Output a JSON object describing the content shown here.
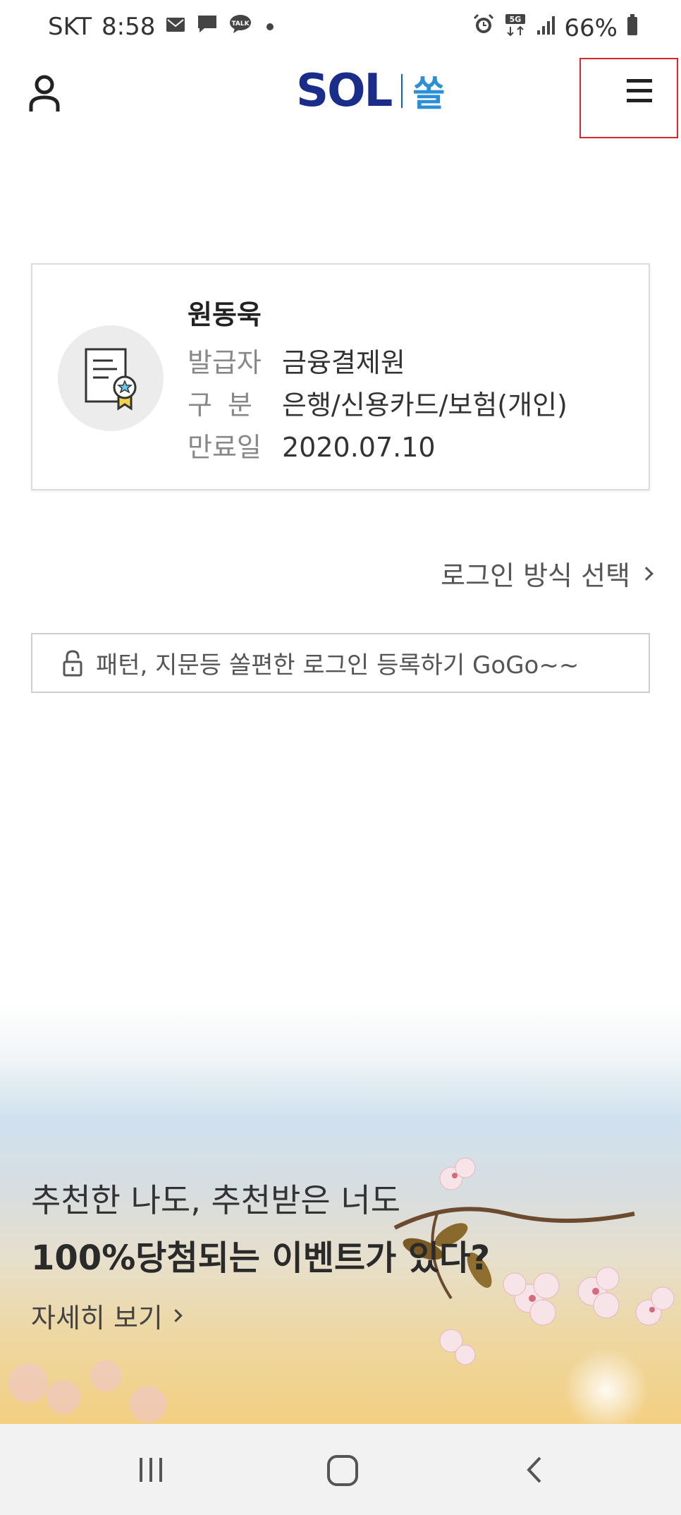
{
  "status_bar": {
    "carrier": "SKT",
    "time": "8:58",
    "network": "5G",
    "battery": "66%",
    "icons_left": [
      "mail-icon",
      "chat-icon",
      "talk-icon",
      "dot-icon"
    ],
    "icons_right": [
      "alarm-icon",
      "5g-icon",
      "signal-icon",
      "battery-icon"
    ]
  },
  "header": {
    "logo_text": "SOL",
    "logo_korean": "쏠",
    "user_icon": "user-icon",
    "menu_icon": "hamburger-menu-icon"
  },
  "certificate": {
    "name": "원동욱",
    "rows": [
      {
        "label": "발급자",
        "value": "금융결제원"
      },
      {
        "label": "구분",
        "value": "은행/신용카드/보험(개인)"
      },
      {
        "label": "만료일",
        "value": "2020.07.10"
      }
    ],
    "icon": "certificate-icon"
  },
  "login_method": {
    "label": "로그인 방식 선택"
  },
  "register": {
    "label": "패턴, 지문등 쏠편한 로그인 등록하기 GoGo~~",
    "icon": "lock-icon"
  },
  "banner": {
    "line1": "추천한 나도, 추천받은 너도",
    "line2": "100%당첨되는 이벤트가 있다?",
    "link": "자세히 보기"
  },
  "nav_bar": {
    "recent_icon": "recent-apps-icon",
    "home_icon": "home-icon",
    "back_icon": "back-icon"
  },
  "colors": {
    "brand_dark": "#1a2d8a",
    "brand_light": "#2b8fd6",
    "highlight_border": "#d9262c"
  }
}
